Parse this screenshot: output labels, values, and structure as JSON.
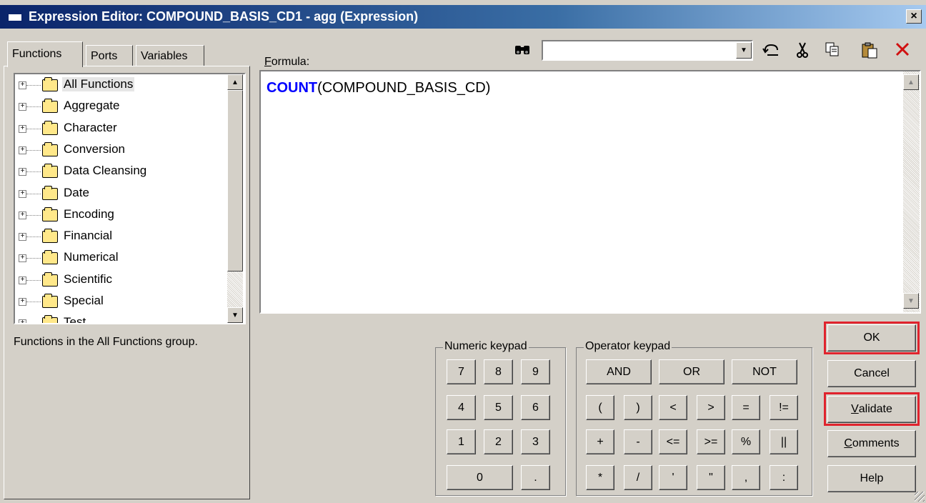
{
  "window": {
    "title": "Expression Editor: COMPOUND_BASIS_CD1 - agg (Expression)",
    "close_glyph": "×"
  },
  "tabs": [
    {
      "label": "Functions",
      "active": true
    },
    {
      "label": "Ports",
      "active": false
    },
    {
      "label": "Variables",
      "active": false
    }
  ],
  "tree": {
    "items": [
      {
        "label": "All Functions",
        "selected": true
      },
      {
        "label": "Aggregate"
      },
      {
        "label": "Character"
      },
      {
        "label": "Conversion"
      },
      {
        "label": "Data Cleansing"
      },
      {
        "label": "Date"
      },
      {
        "label": "Encoding"
      },
      {
        "label": "Financial"
      },
      {
        "label": "Numerical"
      },
      {
        "label": "Scientific"
      },
      {
        "label": "Special"
      },
      {
        "label": "Test"
      }
    ],
    "expand_glyph": "+"
  },
  "description": "Functions in the All Functions group.",
  "formula": {
    "label": "Formula:",
    "keyword": "COUNT",
    "rest": "(COMPOUND_BASIS_CD)"
  },
  "toolbar": {
    "search_value": "",
    "icons": [
      "binoculars-icon",
      "undo-icon",
      "cut-icon",
      "copy-icon",
      "paste-icon",
      "delete-icon"
    ]
  },
  "numeric_keypad": {
    "label": "Numeric keypad",
    "keys": [
      "7",
      "8",
      "9",
      "4",
      "5",
      "6",
      "1",
      "2",
      "3",
      "0",
      "."
    ]
  },
  "operator_keypad": {
    "label": "Operator keypad",
    "row1": [
      "AND",
      "OR",
      "NOT"
    ],
    "row2": [
      "(",
      ")",
      "<",
      ">",
      "=",
      "!="
    ],
    "row3": [
      "+",
      "-",
      "<=",
      ">=",
      "%",
      "||"
    ],
    "row4": [
      "*",
      "/",
      "'",
      "\"",
      ",",
      ":"
    ]
  },
  "buttons": {
    "ok": "OK",
    "cancel": "Cancel",
    "validate": "Validate",
    "comments": "Comments",
    "help": "Help"
  },
  "highlight_color": "#e0232d"
}
